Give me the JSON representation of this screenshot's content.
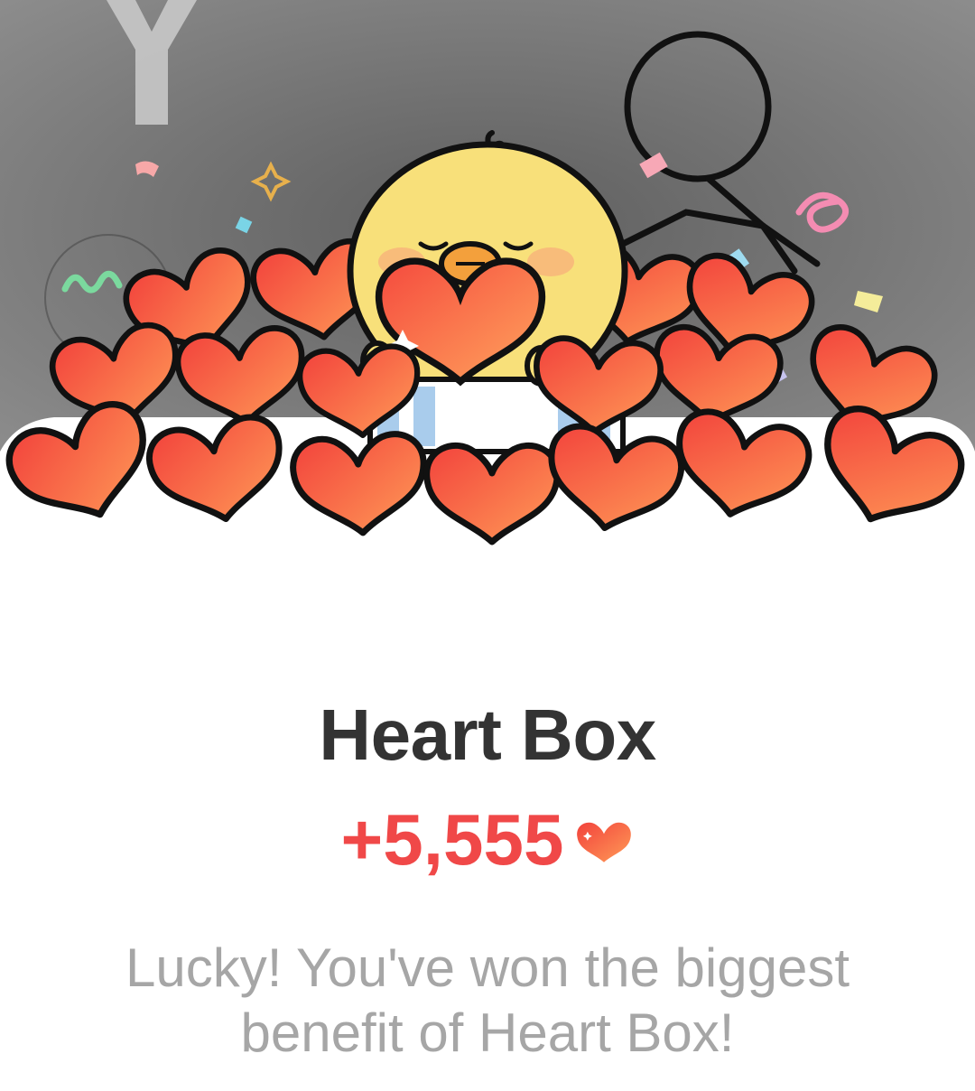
{
  "result": {
    "title": "Heart Box",
    "reward_amount": "+5,555",
    "reward_icon": "heart-icon",
    "message": "Lucky! You've won the biggest benefit of Heart Box!"
  },
  "colors": {
    "title": "#333333",
    "reward": "#f04848",
    "message": "#a6a6a6",
    "heart_light": "#ff9b57",
    "heart_dark": "#f2423c",
    "chick": "#f8e07a",
    "backdrop": "#808080"
  }
}
